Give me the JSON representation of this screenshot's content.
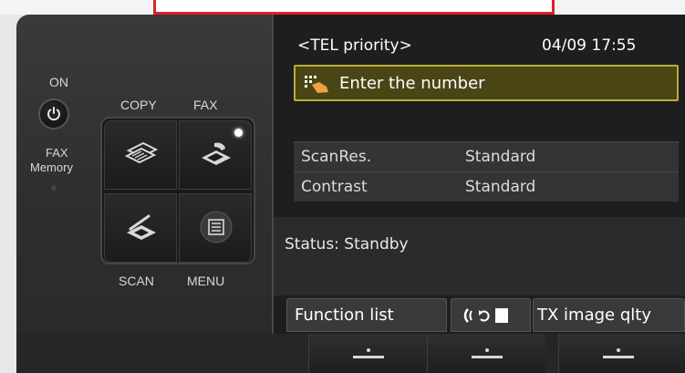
{
  "panel": {
    "on_label": "ON",
    "fax_label": "FAX",
    "memory_label": "Memory",
    "keys": {
      "copy_label": "COPY",
      "fax_label": "FAX",
      "scan_label": "SCAN",
      "menu_label": "MENU"
    }
  },
  "screen": {
    "header_title": "<TEL priority>",
    "header_time": "04/09 17:55",
    "entry_prompt": "Enter the number",
    "settings": [
      {
        "name": "ScanRes.",
        "value": "Standard"
      },
      {
        "name": "Contrast",
        "value": "Standard"
      }
    ],
    "status": "Status: Standby",
    "soft_keys": {
      "function_list": "Function list",
      "tx_image_quality": "TX image qlty"
    }
  },
  "colors": {
    "entry_border": "#b8ac3a",
    "entry_fill": "#4a4514",
    "accent_red": "#e0202a"
  }
}
